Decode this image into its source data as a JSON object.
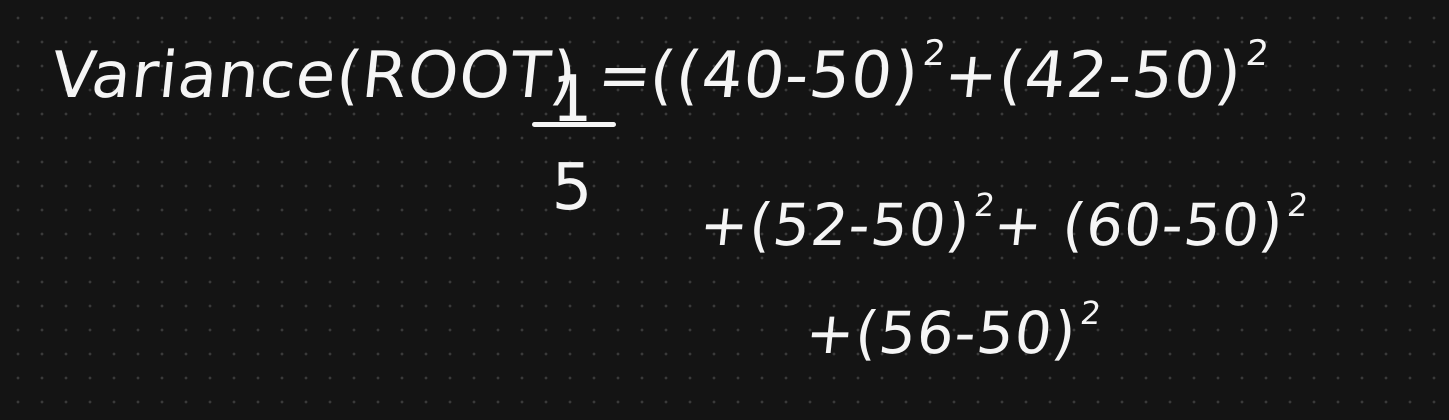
{
  "formula": {
    "lhs": "Variance(ROOT) =",
    "fraction": {
      "numerator": "1",
      "denominator": "5"
    },
    "line1": {
      "open": "((40-50)",
      "exp1": "2",
      "mid": "+(42-50)",
      "exp2": "2"
    },
    "line2": {
      "text1": "+(52-50)",
      "exp1": "2",
      "text2": "+ (60-50)",
      "exp2": "2"
    },
    "line3": {
      "text1": "+(56-50)",
      "exp1": "2"
    }
  },
  "colors": {
    "background": "#141414",
    "ink": "#f5f5f5",
    "grid_dot": "#3a3a3a"
  }
}
